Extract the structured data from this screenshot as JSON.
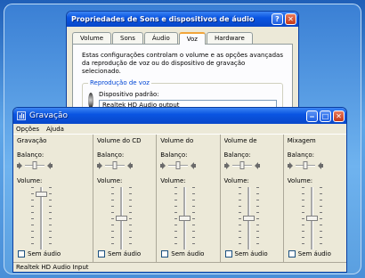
{
  "back_window": {
    "title": "Propriedades de Sons e dispositivos de áudio",
    "help_btn": "?",
    "close_btn": "✕",
    "tabs": [
      "Volume",
      "Sons",
      "Áudio",
      "Voz",
      "Hardware"
    ],
    "description": "Estas configurações controlam o volume e as opções avançadas da reprodução de voz ou do dispositivo de gravação selecionado.",
    "group_label": "Reprodução de voz",
    "device_label": "Dispositivo padrão:",
    "device_value": "Realtek HD Audio output"
  },
  "main_window": {
    "title": "Gravação",
    "menu": [
      "Opções",
      "Ajuda"
    ],
    "balance_label": "Balanço:",
    "volume_label": "Volume:",
    "mute_label": "Sem áudio",
    "channels": [
      {
        "title": "Gravação",
        "volume_level": 0.88
      },
      {
        "title": "Volume do CD",
        "volume_level": 0.5
      },
      {
        "title": "Volume do",
        "volume_level": 0.5
      },
      {
        "title": "Volume de",
        "volume_level": 0.5
      },
      {
        "title": "Mixagem",
        "volume_level": 0.5
      }
    ],
    "status": "Realtek HD Audio Input"
  },
  "colors": {
    "titlebar": "#0a55e2",
    "window_bg": "#ece9d8",
    "active_tab_accent": "#f2a53a"
  }
}
